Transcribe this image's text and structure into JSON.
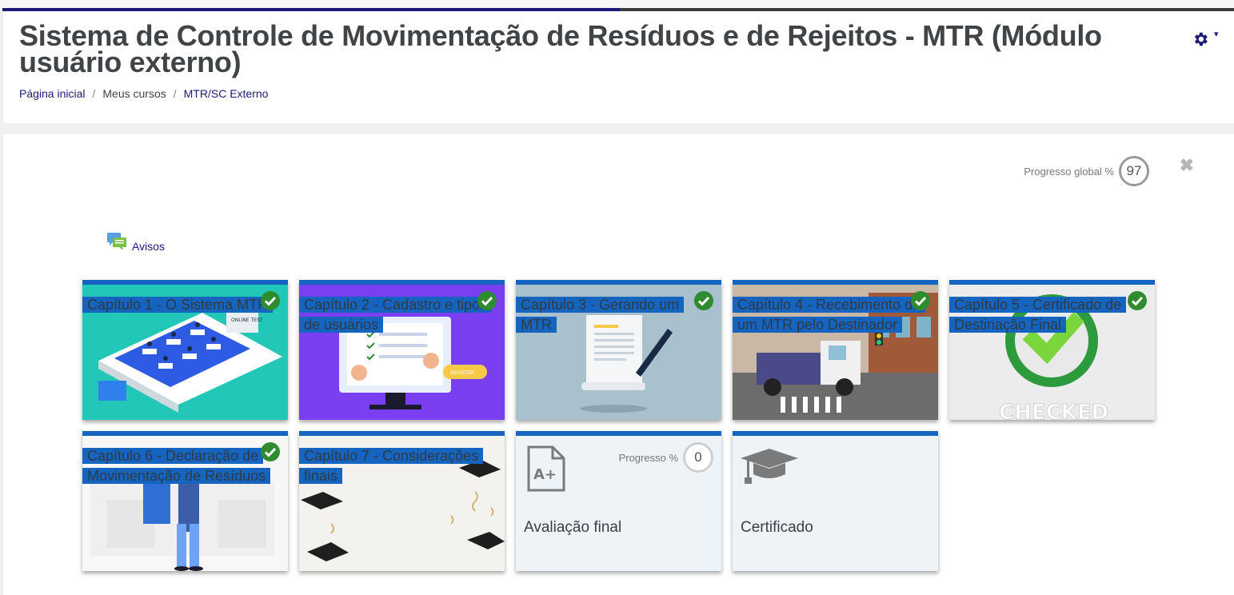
{
  "header": {
    "title": "Sistema de Controle de Movimentação de Resíduos e de Rejeitos - MTR (Módulo usuário externo)",
    "breadcrumb": [
      "Página inicial",
      "Meus cursos",
      "MTR/SC Externo"
    ]
  },
  "progress": {
    "label": "Progresso global %",
    "value": "97"
  },
  "avisos": {
    "label": "Avisos"
  },
  "chapters": [
    {
      "label": "Capítulo 1 - O Sistema MTR",
      "completed": true
    },
    {
      "label": "Capítulo 2 - Cadastro e tipos de usuários",
      "completed": true
    },
    {
      "label": "Capítulo 3 - Gerando um MTR",
      "completed": true
    },
    {
      "label": "Capítulo 4 - Recebimento de um MTR pelo Destinador",
      "completed": true
    },
    {
      "label": "Capítulo 5 - Certificado de Destinação Final",
      "completed": true
    },
    {
      "label": "Capítulo 6 - Declaração de Movimentação de Resíduos",
      "completed": true
    },
    {
      "label": "Capítulo 7 - Considerações finais",
      "completed": false
    }
  ],
  "assessment": {
    "label": "Avaliação final",
    "progress_label": "Progresso %",
    "progress_value": "0"
  },
  "certificate": {
    "label": "Certificado"
  },
  "images": {
    "chapter5_text": "CHECKED",
    "chapter2_button": "REGISTER",
    "chapter1_text": "ONLINE TEST"
  },
  "colors": {
    "accent": "#1565c0",
    "complete": "#2e8b2e",
    "nav": "#1a1a7a"
  }
}
